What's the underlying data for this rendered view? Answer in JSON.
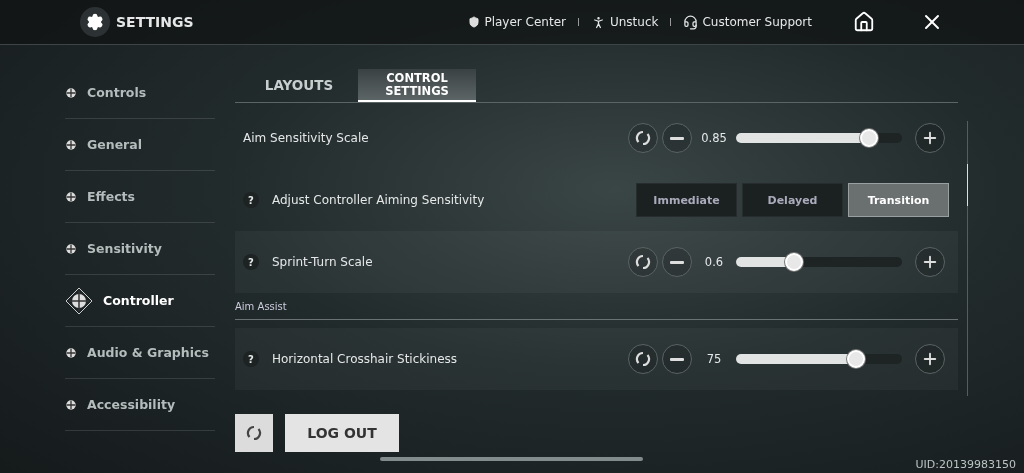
{
  "header": {
    "title": "SETTINGS",
    "links": [
      {
        "label": "Player Center"
      },
      {
        "label": "Unstuck"
      },
      {
        "label": "Customer Support"
      }
    ]
  },
  "sidebar": {
    "items": [
      {
        "label": "Controls",
        "selected": false
      },
      {
        "label": "General",
        "selected": false
      },
      {
        "label": "Effects",
        "selected": false
      },
      {
        "label": "Sensitivity",
        "selected": false
      },
      {
        "label": "Controller",
        "selected": true
      },
      {
        "label": "Audio & Graphics",
        "selected": false
      },
      {
        "label": "Accessibility",
        "selected": false
      }
    ]
  },
  "tabs": [
    {
      "label": "LAYOUTS",
      "selected": false
    },
    {
      "label": "CONTROL\nSETTINGS",
      "selected": true
    }
  ],
  "rows": [
    {
      "kind": "slider",
      "label": "Aim Sensitivity Scale",
      "value": "0.85",
      "level": 0.8
    },
    {
      "kind": "choice",
      "help": "?",
      "label": "Adjust Controller Aiming Sensitivity",
      "options": [
        {
          "label": "Immediate",
          "selected": false
        },
        {
          "label": "Delayed",
          "selected": false
        },
        {
          "label": "Transition",
          "selected": true
        }
      ]
    },
    {
      "kind": "slider",
      "help": "?",
      "label": "Sprint-Turn Scale",
      "value": "0.6",
      "level": 0.35
    },
    {
      "kind": "section",
      "label": "Aim Assist"
    },
    {
      "kind": "slider",
      "help": "?",
      "label": "Horizontal Crosshair Stickiness",
      "value": "75",
      "level": 0.72
    }
  ],
  "footer": {
    "logout": "LOG OUT",
    "uid": "UID:20139983150"
  }
}
